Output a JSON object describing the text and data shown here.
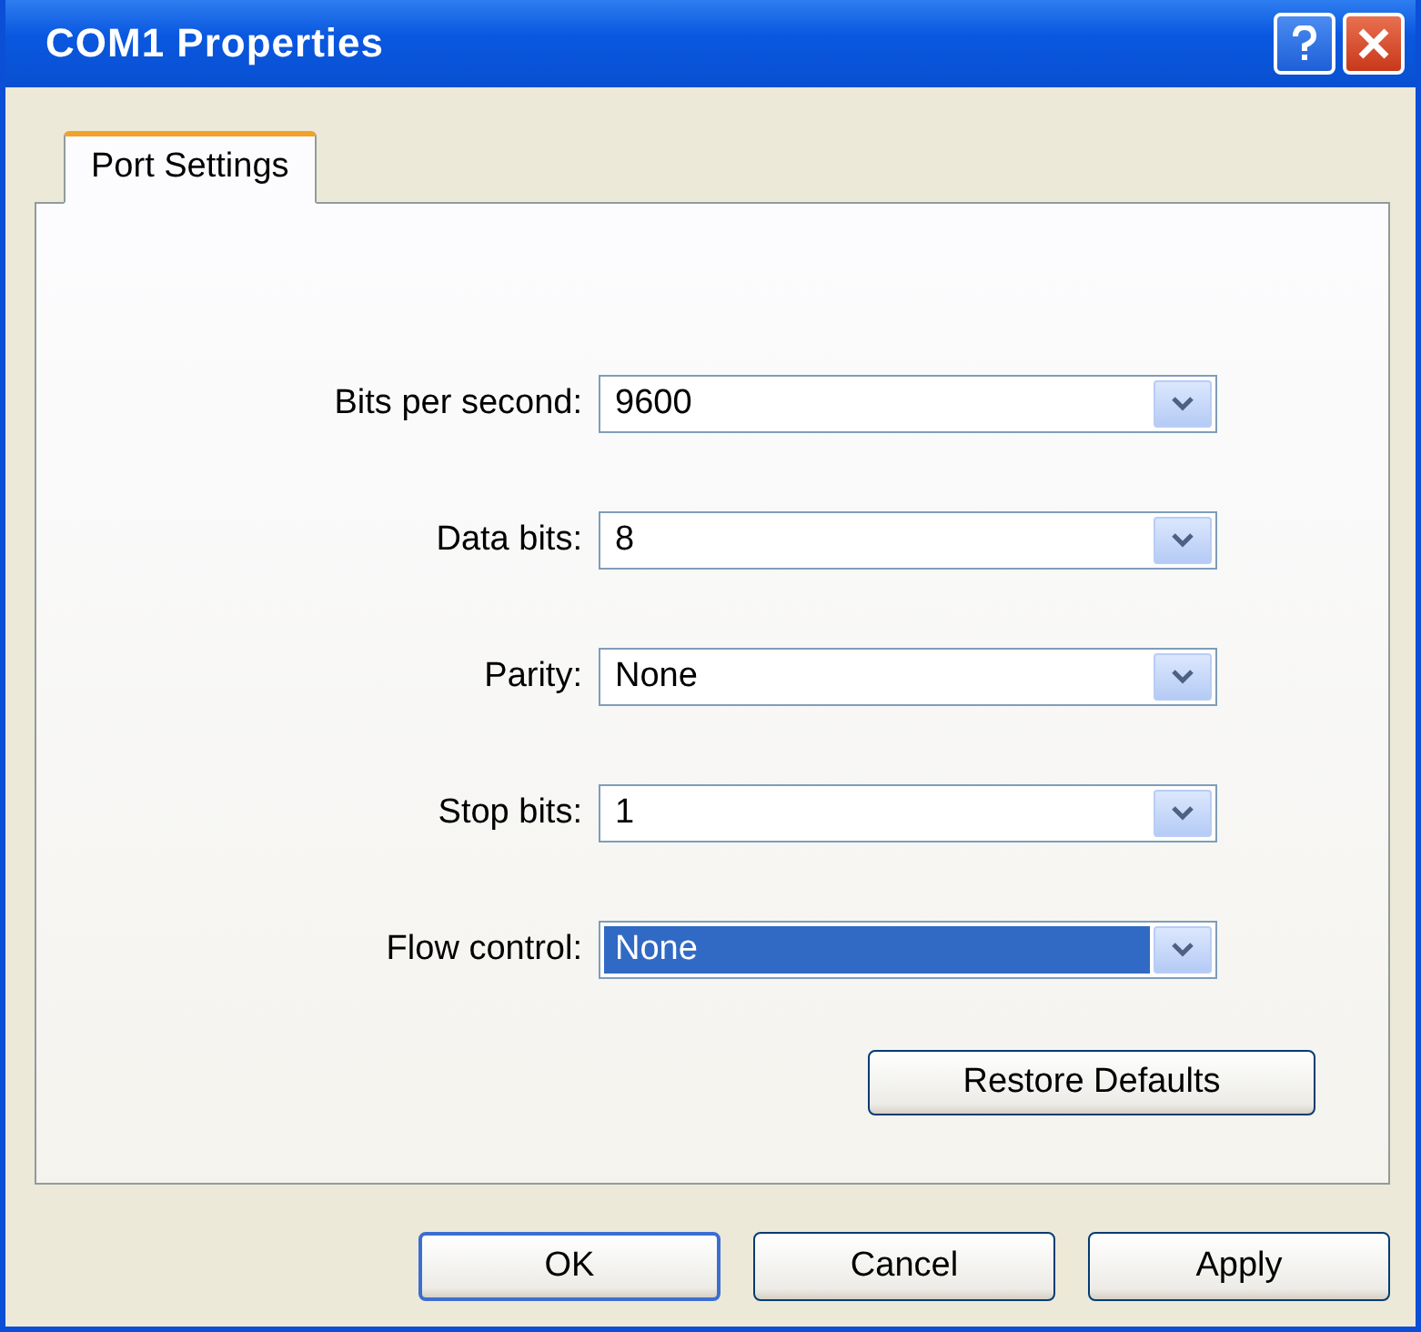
{
  "window": {
    "title": "COM1 Properties"
  },
  "tabs": [
    {
      "label": "Port Settings",
      "selected": true
    }
  ],
  "fields": [
    {
      "label": "Bits per second:",
      "value": "9600",
      "selected": false
    },
    {
      "label": "Data bits:",
      "value": "8",
      "selected": false
    },
    {
      "label": "Parity:",
      "value": "None",
      "selected": false
    },
    {
      "label": "Stop bits:",
      "value": "1",
      "selected": false
    },
    {
      "label": "Flow control:",
      "value": "None",
      "selected": true
    }
  ],
  "restore_button": "Restore Defaults",
  "buttons": [
    {
      "label": "OK",
      "default": true
    },
    {
      "label": "Cancel",
      "default": false
    },
    {
      "label": "Apply",
      "default": false
    }
  ]
}
